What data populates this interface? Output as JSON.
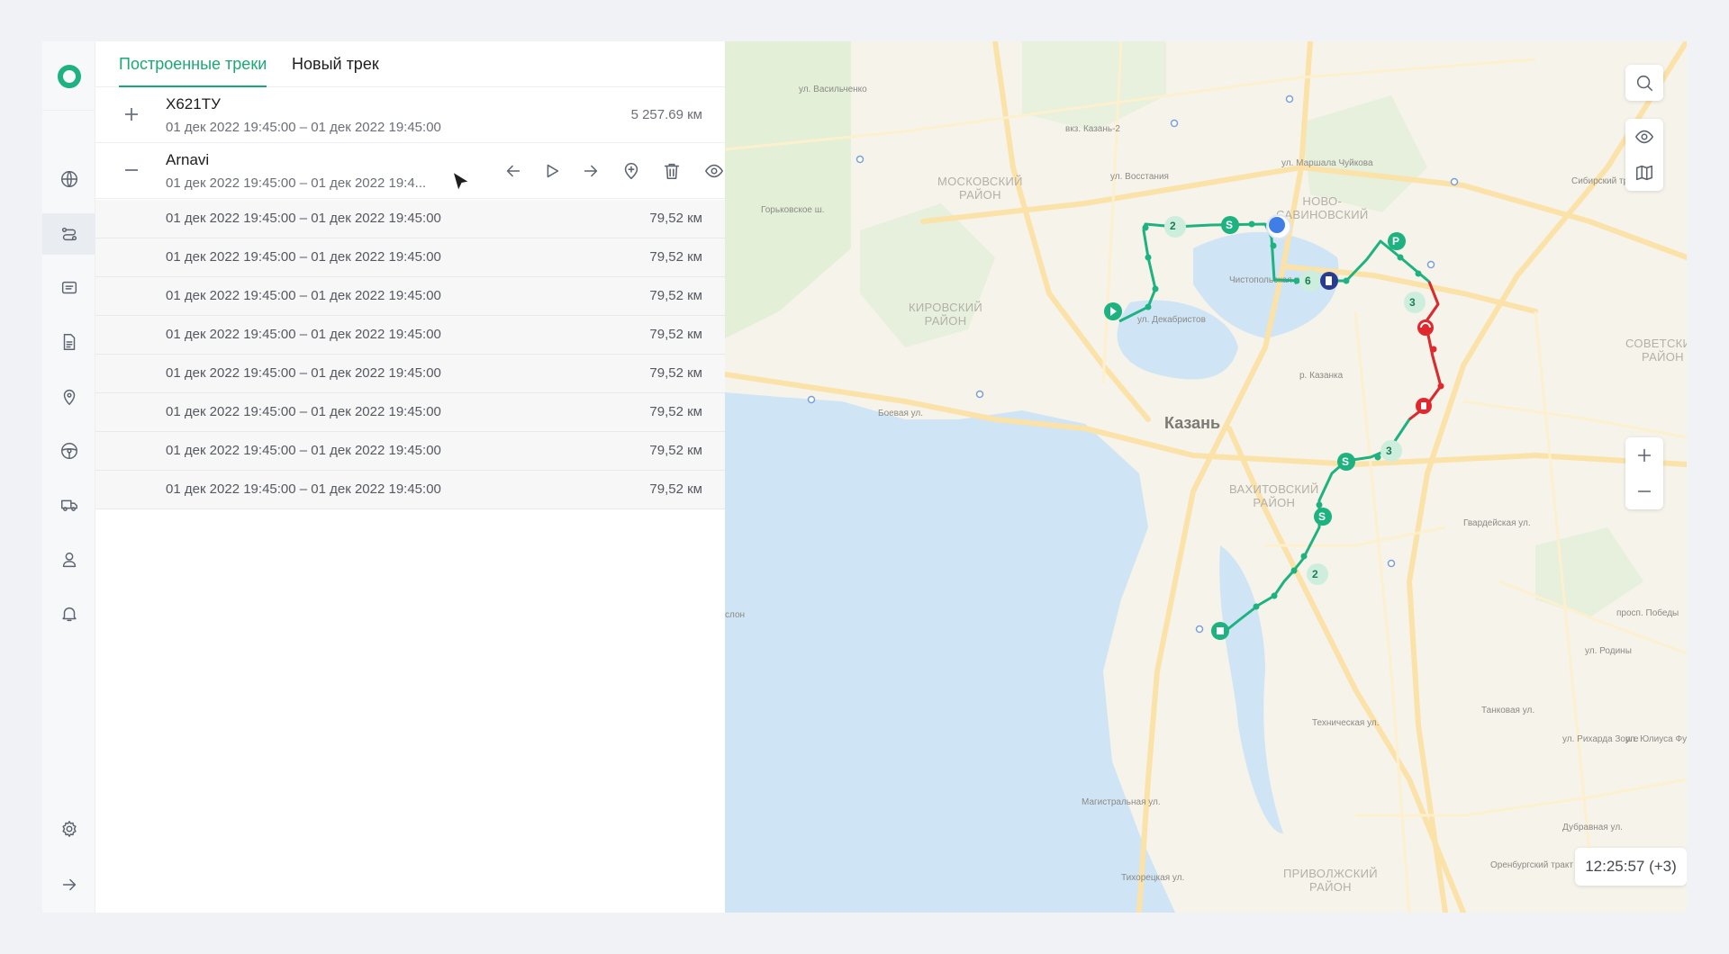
{
  "tabs": {
    "built": "Построенные треки",
    "new": "Новый трек"
  },
  "tracks": [
    {
      "name": "Х621ТУ",
      "dates": "01 дек 2022 19:45:00  –  01 дек 2022 19:45:00",
      "distance": "5 257.69 км",
      "expanded": false
    },
    {
      "name": "Arnavi",
      "dates": "01 дек 2022 19:45:00  –  01 дек 2022 19:4...",
      "distance": "",
      "expanded": true
    }
  ],
  "segments": [
    {
      "dates": "01 дек 2022 19:45:00  –  01 дек 2022 19:45:00",
      "distance": "79,52 км"
    },
    {
      "dates": "01 дек 2022 19:45:00  –  01 дек 2022 19:45:00",
      "distance": "79,52 км"
    },
    {
      "dates": "01 дек 2022 19:45:00  –  01 дек 2022 19:45:00",
      "distance": "79,52 км"
    },
    {
      "dates": "01 дек 2022 19:45:00  –  01 дек 2022 19:45:00",
      "distance": "79,52 км"
    },
    {
      "dates": "01 дек 2022 19:45:00  –  01 дек 2022 19:45:00",
      "distance": "79,52 км"
    },
    {
      "dates": "01 дек 2022 19:45:00  –  01 дек 2022 19:45:00",
      "distance": "79,52 км"
    },
    {
      "dates": "01 дек 2022 19:45:00  –  01 дек 2022 19:45:00",
      "distance": "79,52 км"
    },
    {
      "dates": "01 дек 2022 19:45:00  –  01 дек 2022 19:45:00",
      "distance": "79,52 км"
    }
  ],
  "rail_icons": [
    "globe-icon",
    "route-icon",
    "message-icon",
    "document-icon",
    "location-pin-icon",
    "steering-wheel-icon",
    "truck-icon",
    "user-icon",
    "bell-icon",
    "settings-icon",
    "arrow-right-icon"
  ],
  "track_tools": [
    "arrow-left-icon",
    "play-icon",
    "arrow-right-icon",
    "add-point-icon",
    "trash-icon",
    "eye-icon"
  ],
  "map": {
    "city": "Казань",
    "districts": [
      "МОСКОВСКИЙ\nРАЙОН",
      "КИРОВСКИЙ\nРАЙОН",
      "НОВО-\nСАВИНОВСКИЙ",
      "ВАХИТОВСКИЙ\nРАЙОН",
      "СОВЕТСКИЙ\nРАЙОН",
      "ПРИВОЛЖСКИЙ\nРАЙОН"
    ],
    "streets": [
      "вкз. Казань-2",
      "ул. Восстания",
      "ул. Маршала Чуйкова",
      "Горьковское ш.",
      "Чистопольская ул.",
      "ул. Декабристов",
      "Боевая ул.",
      "р. Казанка",
      "Гвардейская ул.",
      "Техническая ул.",
      "Магистральная ул.",
      "Тихорецкая ул.",
      "Танковая ул.",
      "Дубравная ул.",
      "Оренбургский тракт",
      "просп. Победы",
      "ул. Юлиуса Фучика",
      "ул. Рихарда Зорге",
      "ул. Родины",
      "Сибирский тракт",
      "ул. Васильченко",
      "слон"
    ],
    "markers": [
      "2",
      "S",
      "6",
      "P",
      "3",
      "3",
      "S",
      "S",
      "2"
    ],
    "clock": "12:25:57 (+3)",
    "track_color": "#1db27f",
    "alert_color": "#e0282e",
    "fuel_color": "#2a3b8f",
    "position_color": "#3f7de8"
  },
  "colors": {
    "accent": "#1aa874"
  }
}
